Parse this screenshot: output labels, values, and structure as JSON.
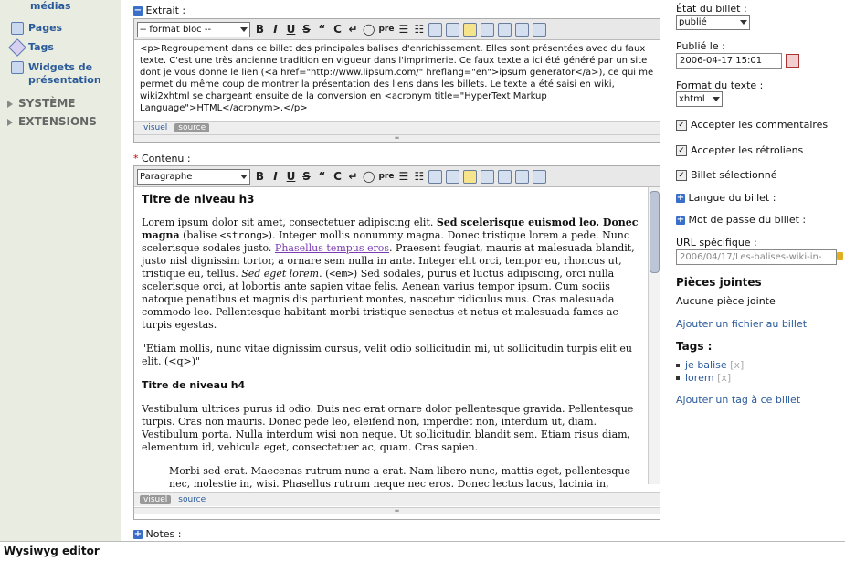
{
  "sidebar": {
    "items": [
      {
        "label": "médias",
        "icon": "media-icon"
      },
      {
        "label": "Pages",
        "icon": "pages-icon"
      },
      {
        "label": "Tags",
        "icon": "tag-icon"
      },
      {
        "label": "Widgets de présentation",
        "icon": "widgets-icon"
      }
    ],
    "sections": [
      "SYSTÈME",
      "EXTENSIONS"
    ]
  },
  "extrait": {
    "label": "Extrait :",
    "format_select": "-- format bloc --",
    "text": "<p>Regroupement dans ce billet des principales balises d'enrichissement. Elles sont présentées avec du faux texte. C'est une très ancienne tradition en vigueur dans l'imprimerie. Ce faux texte a ici été généré par un site dont je vous donne le lien (<a href=\"http://www.lipsum.com/\" hreflang=\"en\">ipsum generator</a>), ce qui me permet du même coup de montrer la présentation des liens dans les billets. Le texte a été saisi en wiki, wiki2xhtml se chargeant ensuite de la conversion en <acronym title=\"HyperText Markup Language\">HTML</acronym>.</p>",
    "tab_visual": "visuel",
    "tab_source": "source"
  },
  "contenu": {
    "required_mark": "*",
    "label": "Contenu :",
    "format_select": "Paragraphe",
    "h3": "Titre de niveau h3",
    "p1_a": "Lorem ipsum dolor sit amet, consectetuer adipiscing elit. ",
    "p1_strong": "Sed scelerisque euismod leo. Donec magna",
    "p1_b": " (balise ",
    "p1_code1": "<strong>",
    "p1_c": "). Integer mollis nonummy magna. Donec tristique lorem a pede. Nunc scelerisque sodales justo. ",
    "p1_link": "Phasellus tempus eros",
    "p1_d": ". Praesent feugiat, mauris at malesuada blandit, justo nisl dignissim tortor, a ornare sem nulla in ante. Integer elit orci, tempor eu, rhoncus ut, tristique eu, tellus. ",
    "p1_em": "Sed eget lorem",
    "p1_e": ". (",
    "p1_code2": "<em>",
    "p1_f": ") Sed sodales, purus et luctus adipiscing, orci nulla scelerisque orci, at lobortis ante sapien vitae felis. Aenean varius tempor ipsum. Cum sociis natoque penatibus et magnis dis parturient montes, nascetur ridiculus mus. Cras malesuada commodo leo. Pellentesque habitant morbi tristique senectus et netus et malesuada fames ac turpis egestas.",
    "q": "\"Etiam mollis, nunc vitae dignissim cursus, velit odio sollicitudin mi, ut sollicitudin turpis elit eu elit. (<q>)\"",
    "h4": "Titre de niveau h4",
    "p2": "Vestibulum ultrices purus id odio. Duis nec erat ornare dolor pellentesque gravida. Pellentesque turpis. Cras non mauris. Donec pede leo, eleifend non, imperdiet non, interdum ut, diam. Vestibulum porta. Nulla interdum wisi non neque. Ut sollicitudin blandit sem. Etiam risus diam, elementum id, vehicula eget, consectetuer ac, quam. Cras sapien.",
    "bq": "Morbi sed erat. Maecenas rutrum nunc a erat. Nam libero nunc, mattis eget, pellentesque nec, molestie in, wisi. Phasellus rutrum neque nec eros. Donec lectus lacus, lacinia in, lacinia non, semper eget, lectus. In hac habitasse platea dictumst.",
    "tab_visual": "visuel",
    "tab_source": "source"
  },
  "notes": {
    "label": "Notes :"
  },
  "right": {
    "etat_label": "État du billet :",
    "etat_value": "publié",
    "publie_label": "Publié le :",
    "publie_value": "2006-04-17 15:01",
    "format_label": "Format du texte :",
    "format_value": "xhtml",
    "cb_comments": "Accepter les commentaires",
    "cb_trackbacks": "Accepter les rétroliens",
    "cb_selected": "Billet sélectionné",
    "langue": "Langue du billet :",
    "motdepasse": "Mot de passe du billet :",
    "url_label": "URL spécifique :",
    "url_value": "2006/04/17/Les-balises-wiki-in-",
    "pj_title": "Pièces jointes",
    "pj_none": "Aucune pièce jointe",
    "pj_add": "Ajouter un fichier au billet",
    "tags_title": "Tags :",
    "tags": [
      "je balise",
      "lorem"
    ],
    "tag_remove": "[x]",
    "tags_add": "Ajouter un tag à ce billet"
  },
  "footer": {
    "caption": "Wysiwyg editor"
  }
}
